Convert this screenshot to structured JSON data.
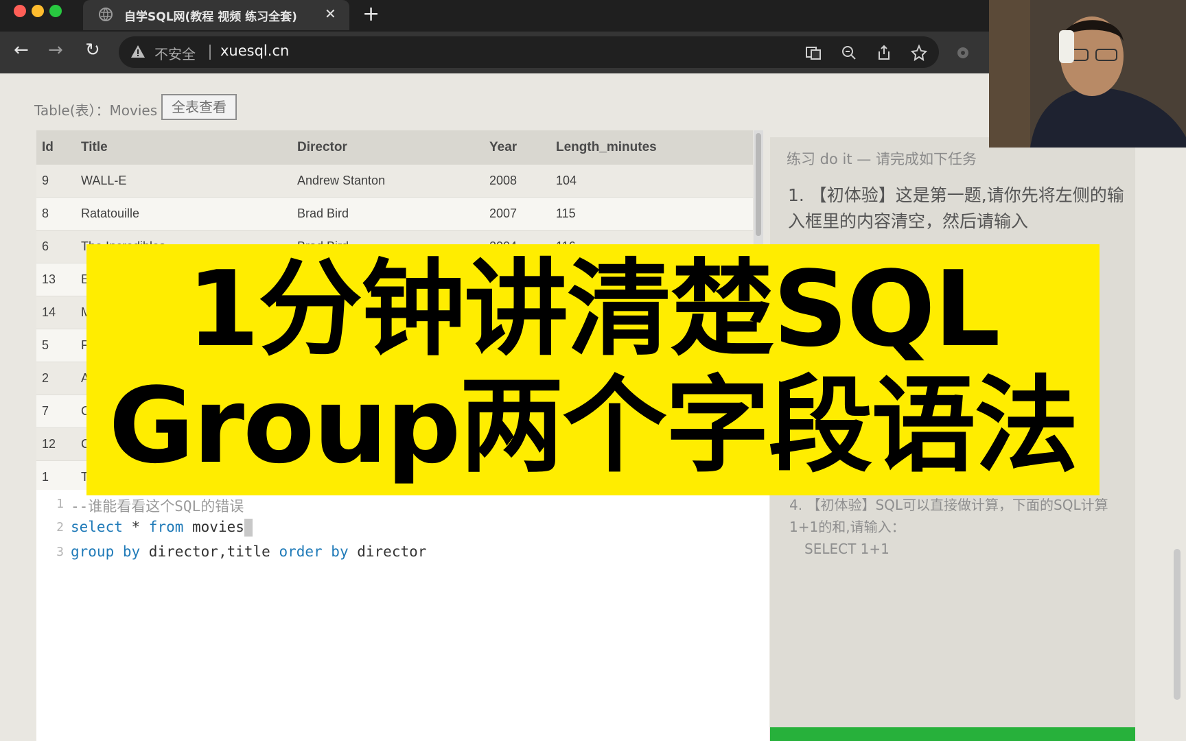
{
  "browser": {
    "tab_title": "自学SQL网(教程 视频 练习全套)",
    "tab_close": "✕",
    "new_tab": "+",
    "security_label": "不安全",
    "url": "xuesql.cn",
    "colors": {
      "close": "#ff5f57",
      "minimize": "#febc2e",
      "zoom": "#28c840"
    }
  },
  "table_header": {
    "label": "Table(表）：Movies",
    "view_all_button": "全表查看"
  },
  "table": {
    "columns": [
      "Id",
      "Title",
      "Director",
      "Year",
      "Length_minutes"
    ],
    "rows": [
      [
        "9",
        "WALL-E",
        "Andrew Stanton",
        "2008",
        "104"
      ],
      [
        "8",
        "Ratatouille",
        "Brad Bird",
        "2007",
        "115"
      ],
      [
        "6",
        "The Incredibles",
        "Brad Bird",
        "2004",
        "116"
      ],
      [
        "13",
        "E",
        "",
        "",
        ""
      ],
      [
        "14",
        "M",
        "",
        "",
        ""
      ],
      [
        "5",
        "F",
        "",
        "",
        ""
      ],
      [
        "2",
        "A",
        "",
        "",
        ""
      ],
      [
        "7",
        "C",
        "",
        "",
        ""
      ],
      [
        "12",
        "C",
        "",
        "",
        ""
      ],
      [
        "1",
        "T",
        "",
        "",
        ""
      ]
    ]
  },
  "editor": {
    "lines": [
      {
        "num": "1",
        "comment": "--谁能看看这个SQL的错误"
      },
      {
        "num": "2",
        "kw1": "select",
        "t1": " * ",
        "kw2": "from",
        "t2": " movies"
      },
      {
        "num": "3",
        "kw1": "group by",
        "t1": " director,title ",
        "kw2": "order by",
        "t2": " director"
      }
    ]
  },
  "exercise": {
    "title": "练习 do it — 请完成如下任务",
    "task1": "1. 【初体验】这是第一题,请你先将左侧的输入框里的内容清空，然后请输入",
    "task4": "4. 【初体验】SQL可以直接做计算，下面的SQL计算1+1的和,请输入：",
    "task4_sql": "SELECT 1+1"
  },
  "banner": {
    "line1": "1分钟讲清楚SQL",
    "line2": "Group两个字段语法"
  }
}
